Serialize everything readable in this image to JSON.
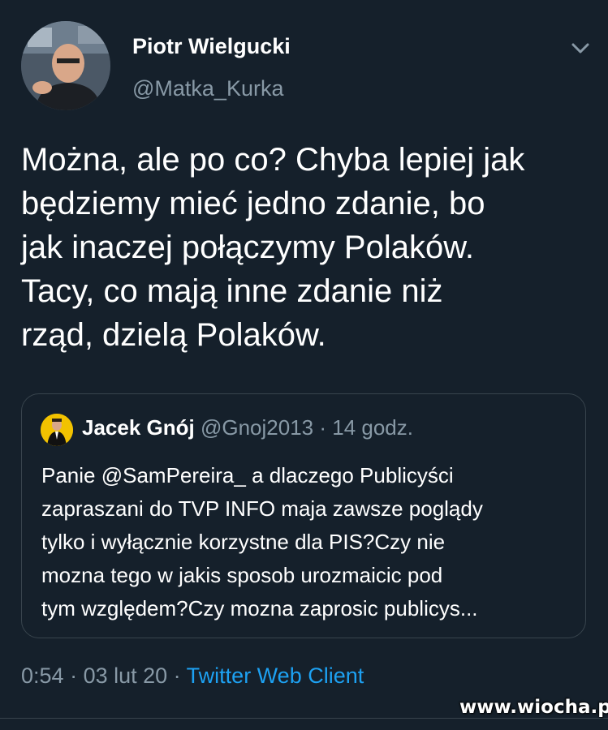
{
  "author": {
    "name": "Piotr Wielgucki",
    "handle": "@Matka_Kurka"
  },
  "tweet": {
    "lines": [
      "Można, ale po co? Chyba lepiej jak",
      "będziemy mieć jedno zdanie, bo",
      "jak inaczej połączymy Polaków.",
      "Tacy, co mają inne zdanie niż",
      "rząd, dzielą Polaków."
    ]
  },
  "quoted": {
    "name": "Jacek Gnój",
    "handle": "@Gnoj2013",
    "separator": " · ",
    "time": "14 godz.",
    "lines": [
      "Panie @SamPereira_ a dlaczego Publicyści",
      "zapraszani do TVP INFO maja zawsze poglądy",
      "tylko i wyłącznie korzystne dla PIS?Czy nie",
      "mozna tego w jakis sposob urozmaicic pod",
      "tym względem?Czy mozna zaprosic publicys..."
    ]
  },
  "footer": {
    "time": "0:54",
    "separator": " · ",
    "date": "03 lut 20",
    "client": "Twitter Web Client"
  },
  "watermark": "www.wiocha.pl",
  "colors": {
    "background": "#15202b",
    "secondary_text": "#8899a6",
    "link": "#1da1f2",
    "border": "#38444d"
  },
  "icons": {
    "caret": "chevron-down-icon"
  }
}
